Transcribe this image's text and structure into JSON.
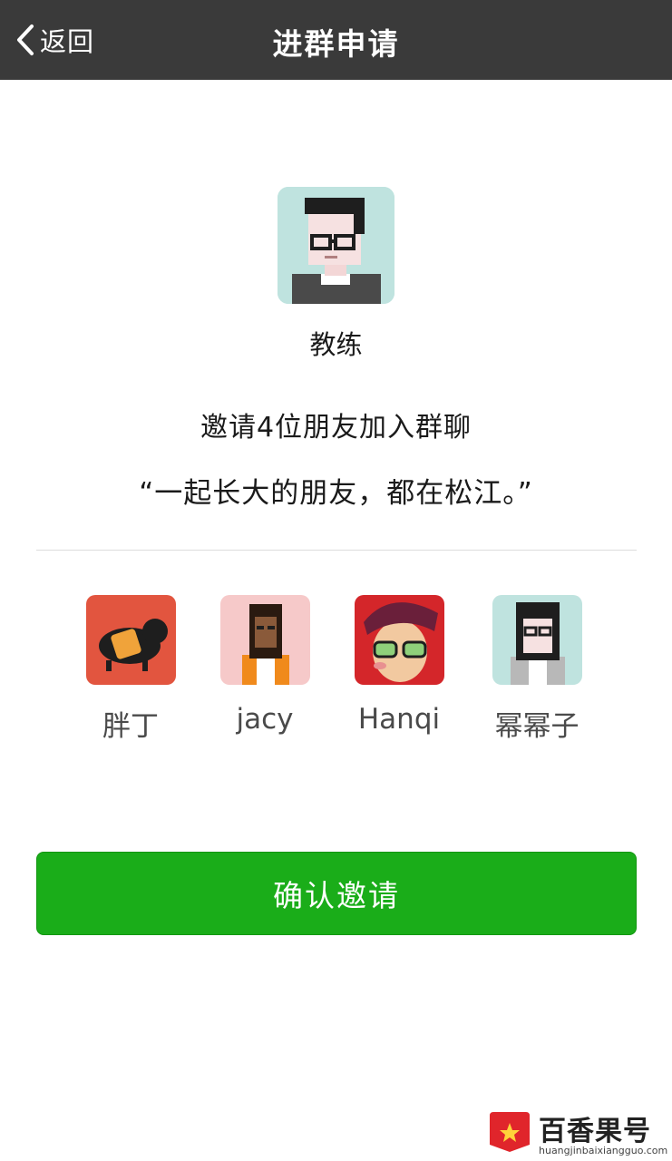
{
  "nav": {
    "back_label": "返回",
    "title": "进群申请"
  },
  "inviter": {
    "name": "教练"
  },
  "invite_text": "邀请4位朋友加入群聊",
  "group_name": "“一起长大的朋友，都在松江。”",
  "members": [
    {
      "name": "胖丁"
    },
    {
      "name": "jacy"
    },
    {
      "name": "Hanqi"
    },
    {
      "name": "幂幂子"
    }
  ],
  "confirm_label": "确认邀请",
  "watermark": {
    "brand": "百香果号",
    "url": "huangjinbaixiangguo.com"
  },
  "colors": {
    "navbar": "#3a3a3a",
    "button": "#1aad19"
  }
}
